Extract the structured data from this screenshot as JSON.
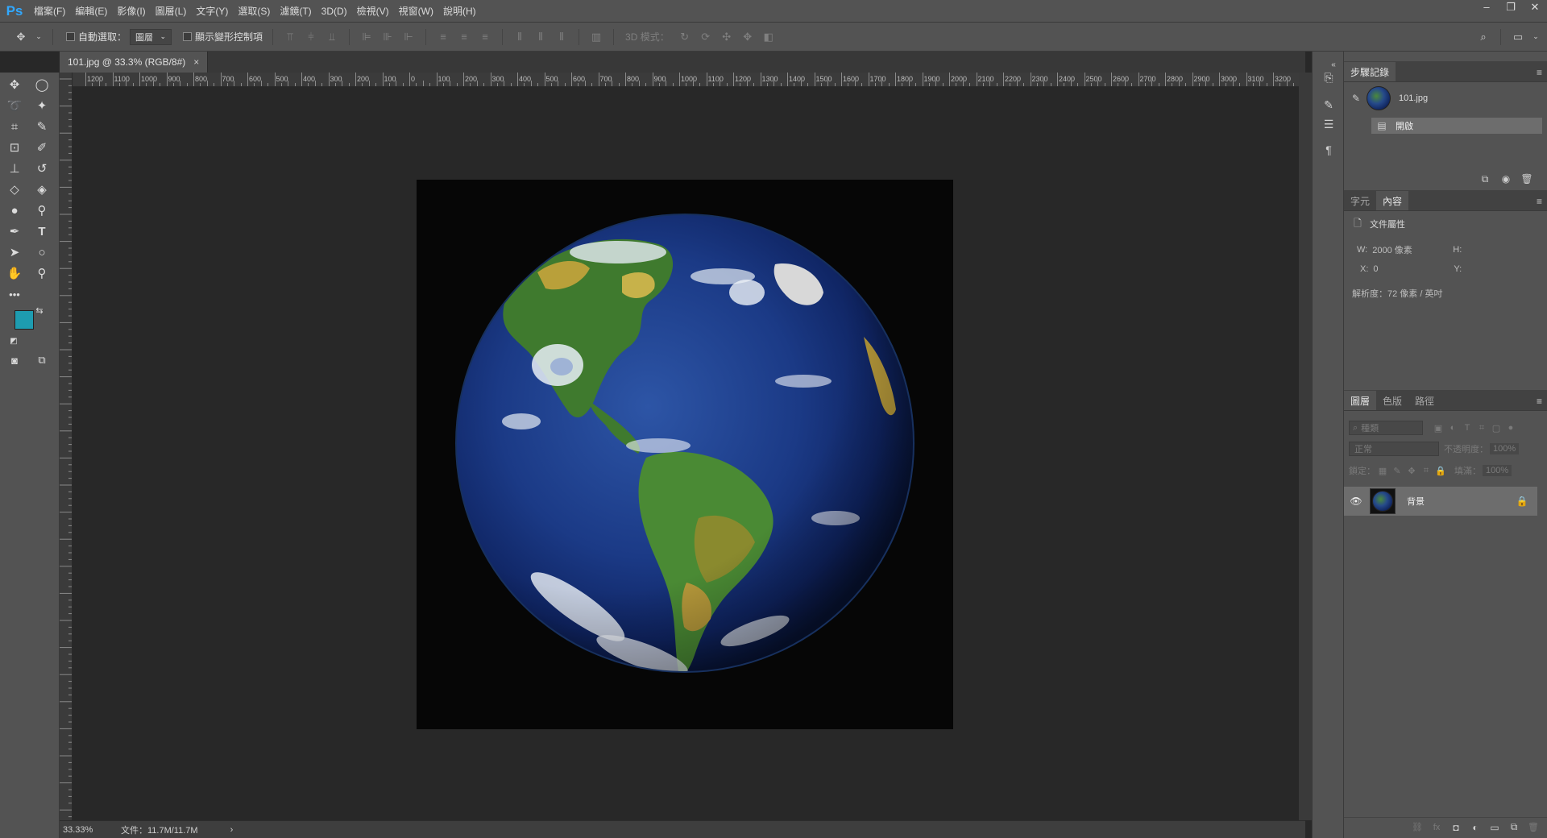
{
  "app": {
    "logo": "Ps"
  },
  "menu": [
    "檔案(F)",
    "編輯(E)",
    "影像(I)",
    "圖層(L)",
    "文字(Y)",
    "選取(S)",
    "濾鏡(T)",
    "3D(D)",
    "檢視(V)",
    "視窗(W)",
    "說明(H)"
  ],
  "window_controls": {
    "minimize": "–",
    "restore": "❐",
    "close": "✕"
  },
  "options": {
    "auto_select_label": "自動選取：",
    "auto_select_value": "圖層",
    "show_transform_label": "顯示變形控制項",
    "mode3d_label": "3D 模式："
  },
  "document": {
    "tab_title": "101.jpg @ 33.3% (RGB/8#)",
    "close": "×",
    "zoom": "33.33%",
    "file_info": "文件：11.7M/11.7M",
    "status_arrow": "›"
  },
  "ruler_top_labels": [
    "1200",
    "1100",
    "1000",
    "900",
    "800",
    "700",
    "600",
    "500",
    "400",
    "300",
    "200",
    "100",
    "0",
    "100",
    "200",
    "300",
    "400",
    "500",
    "600",
    "700",
    "800",
    "900",
    "1000",
    "1100",
    "1200",
    "1300",
    "1400",
    "1500",
    "1600",
    "1700",
    "1800",
    "1900",
    "2000",
    "2100",
    "2200",
    "2300",
    "2400",
    "2500",
    "2600",
    "2700",
    "2800",
    "2900",
    "3000",
    "3100",
    "3200"
  ],
  "history_panel": {
    "title": "步驟記錄",
    "snapshot_name": "101.jpg",
    "steps": [
      "開啟"
    ]
  },
  "properties_panel": {
    "tabs": [
      "字元",
      "內容"
    ],
    "active_tab": "內容",
    "section_title": "文件屬性",
    "w_label": "W:",
    "w_value": "2000 像素",
    "h_label": "H:",
    "x_label": "X:",
    "x_value": "0",
    "y_label": "Y:",
    "resolution": "解析度：72 像素 / 英吋"
  },
  "layers_panel": {
    "tabs": [
      "圖層",
      "色版",
      "路徑"
    ],
    "active_tab": "圖層",
    "filter_placeholder": "種類",
    "blend_mode": "正常",
    "opacity_label": "不透明度：",
    "opacity_value": "100%",
    "lock_label": "鎖定：",
    "fill_label": "填滿：",
    "fill_value": "100%",
    "layers": [
      {
        "name": "背景",
        "locked": true,
        "visible": true
      }
    ]
  },
  "colors": {
    "foreground": "#1e9cb0",
    "background": "#ffffff",
    "accent": "#31a8ff"
  }
}
